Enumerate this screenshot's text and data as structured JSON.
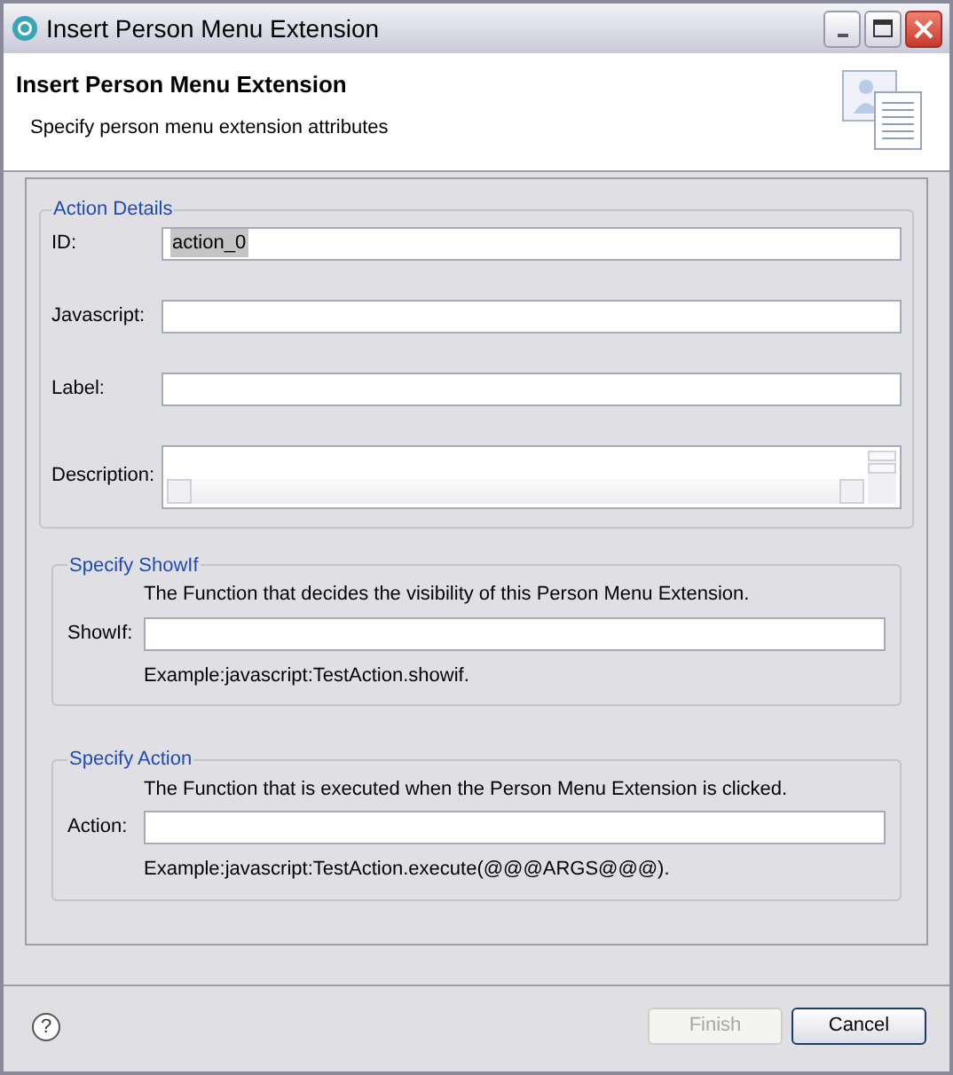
{
  "window": {
    "title": "Insert Person Menu Extension"
  },
  "header": {
    "title": "Insert Person Menu Extension",
    "subtitle": "Specify person menu extension attributes"
  },
  "action_details": {
    "legend": "Action Details",
    "fields": [
      {
        "kind": "text",
        "label": "ID:",
        "value": "action_0",
        "value_selected": true
      },
      {
        "kind": "text",
        "label": "Javascript:"
      },
      {
        "kind": "text",
        "label": "Label:"
      },
      {
        "kind": "textarea",
        "label": "Description:"
      }
    ]
  },
  "groups": [
    {
      "legend": "Specify ShowIf",
      "description": "The Function that decides the visibility of this Person Menu Extension.",
      "label": "ShowIf:",
      "example": "Example:javascript:TestAction.showif."
    },
    {
      "legend": "Specify Action",
      "description": "The Function that is executed when the Person Menu Extension is clicked.",
      "label": "Action:",
      "example": "Example:javascript:TestAction.execute(@@@ARGS@@@)."
    }
  ],
  "help": {
    "glyph": "?"
  },
  "buttons": [
    {
      "label": "Finish",
      "disabled": true
    },
    {
      "label": "Cancel",
      "disabled": false
    }
  ]
}
